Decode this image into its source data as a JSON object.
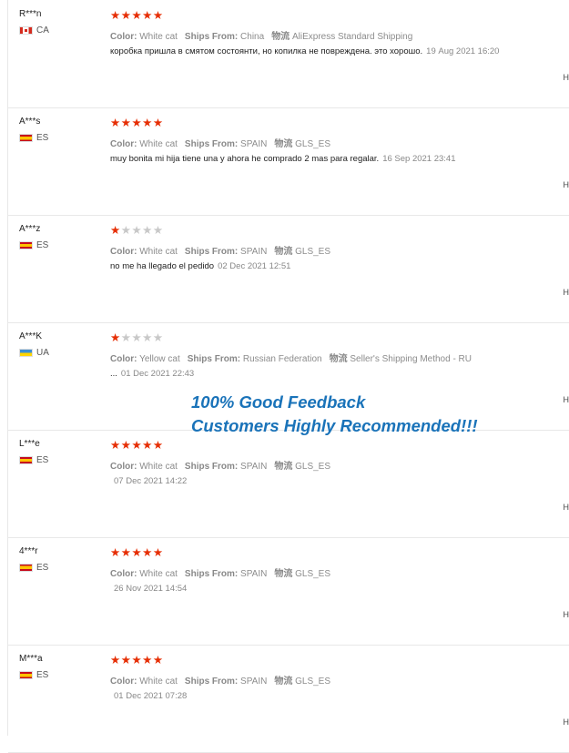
{
  "reviews": [
    {
      "user": "R***n",
      "country": "CA",
      "flag": "ca",
      "rating": 5,
      "color_label": "Color:",
      "color": "White cat",
      "ships_label": "Ships From:",
      "ships_from": "China",
      "logistics_label": "物流",
      "logistics": "AliExpress Standard Shipping",
      "text": "коробка пришла в смятом состоянти, но копилка не повреждена. это хорошо.",
      "date": "19 Aug 2021 16:20",
      "helpful": "H"
    },
    {
      "user": "A***s",
      "country": "ES",
      "flag": "es",
      "rating": 5,
      "color_label": "Color:",
      "color": "White cat",
      "ships_label": "Ships From:",
      "ships_from": "SPAIN",
      "logistics_label": "物流",
      "logistics": "GLS_ES",
      "text": "muy bonita mi hija tiene una y ahora he comprado 2 mas para regalar.",
      "date": "16 Sep 2021 23:41",
      "helpful": "H"
    },
    {
      "user": "A***z",
      "country": "ES",
      "flag": "es",
      "rating": 1,
      "color_label": "Color:",
      "color": "White cat",
      "ships_label": "Ships From:",
      "ships_from": "SPAIN",
      "logistics_label": "物流",
      "logistics": "GLS_ES",
      "text": "no me ha llegado el pedido",
      "date": "02 Dec 2021 12:51",
      "helpful": "H"
    },
    {
      "user": "A***K",
      "country": "UA",
      "flag": "ua",
      "rating": 1,
      "color_label": "Color:",
      "color": "Yellow cat",
      "ships_label": "Ships From:",
      "ships_from": "Russian Federation",
      "logistics_label": "物流",
      "logistics": "Seller's Shipping Method - RU",
      "text": "...",
      "date": "01 Dec 2021 22:43",
      "helpful": "H"
    },
    {
      "user": "L***e",
      "country": "ES",
      "flag": "es",
      "rating": 5,
      "color_label": "Color:",
      "color": "White cat",
      "ships_label": "Ships From:",
      "ships_from": "SPAIN",
      "logistics_label": "物流",
      "logistics": "GLS_ES",
      "text": "",
      "date": "07 Dec 2021 14:22",
      "helpful": "H"
    },
    {
      "user": "4***r",
      "country": "ES",
      "flag": "es",
      "rating": 5,
      "color_label": "Color:",
      "color": "White cat",
      "ships_label": "Ships From:",
      "ships_from": "SPAIN",
      "logistics_label": "物流",
      "logistics": "GLS_ES",
      "text": "",
      "date": "26 Nov 2021 14:54",
      "helpful": "H"
    },
    {
      "user": "M***a",
      "country": "ES",
      "flag": "es",
      "rating": 5,
      "color_label": "Color:",
      "color": "White cat",
      "ships_label": "Ships From:",
      "ships_from": "SPAIN",
      "logistics_label": "物流",
      "logistics": "GLS_ES",
      "text": "",
      "date": "01 Dec 2021 07:28",
      "helpful": "H"
    }
  ],
  "banner": {
    "line1": "100% Good Feedback",
    "line2": "Customers Highly Recommended!!!"
  },
  "colors": {
    "star_on": "#e62e04",
    "star_off": "#c8c8c8",
    "banner": "#1a73b9"
  }
}
